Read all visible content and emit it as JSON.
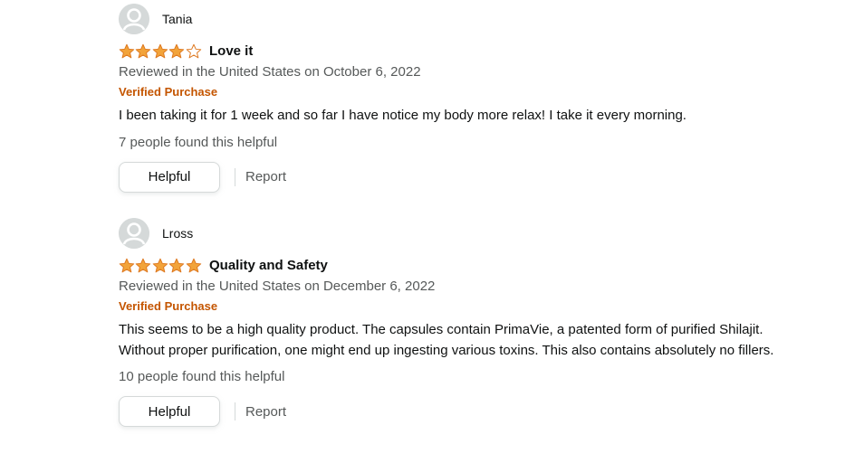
{
  "colors": {
    "star_fill": "#f2a33a",
    "star_outline": "#de7921",
    "verified": "#c45500",
    "muted_text": "#565959",
    "avatar_bg": "#d5d9d9"
  },
  "reviews": [
    {
      "username": "Tania",
      "rating": 4,
      "max_rating": 5,
      "title": "Love it",
      "date_line": "Reviewed in the United States on October 6, 2022",
      "badge": "Verified Purchase",
      "body": "I been taking it for 1 week and so far I have notice my body more relax! I take it every morning.",
      "helpful_count_text": "7 people found this helpful",
      "helpful_button": "Helpful",
      "report_link": "Report"
    },
    {
      "username": "Lross",
      "rating": 5,
      "max_rating": 5,
      "title": "Quality and Safety",
      "date_line": "Reviewed in the United States on December 6, 2022",
      "badge": "Verified Purchase",
      "body": "This seems to be a high quality product. The capsules contain PrimaVie, a patented form of purified Shilajit. Without proper purification, one might end up ingesting various toxins. This also contains absolutely no fillers.",
      "helpful_count_text": "10 people found this helpful",
      "helpful_button": "Helpful",
      "report_link": "Report"
    }
  ],
  "icons": {
    "avatar": "user-avatar-icon",
    "star_full": "star-filled-icon",
    "star_empty": "star-empty-icon"
  }
}
